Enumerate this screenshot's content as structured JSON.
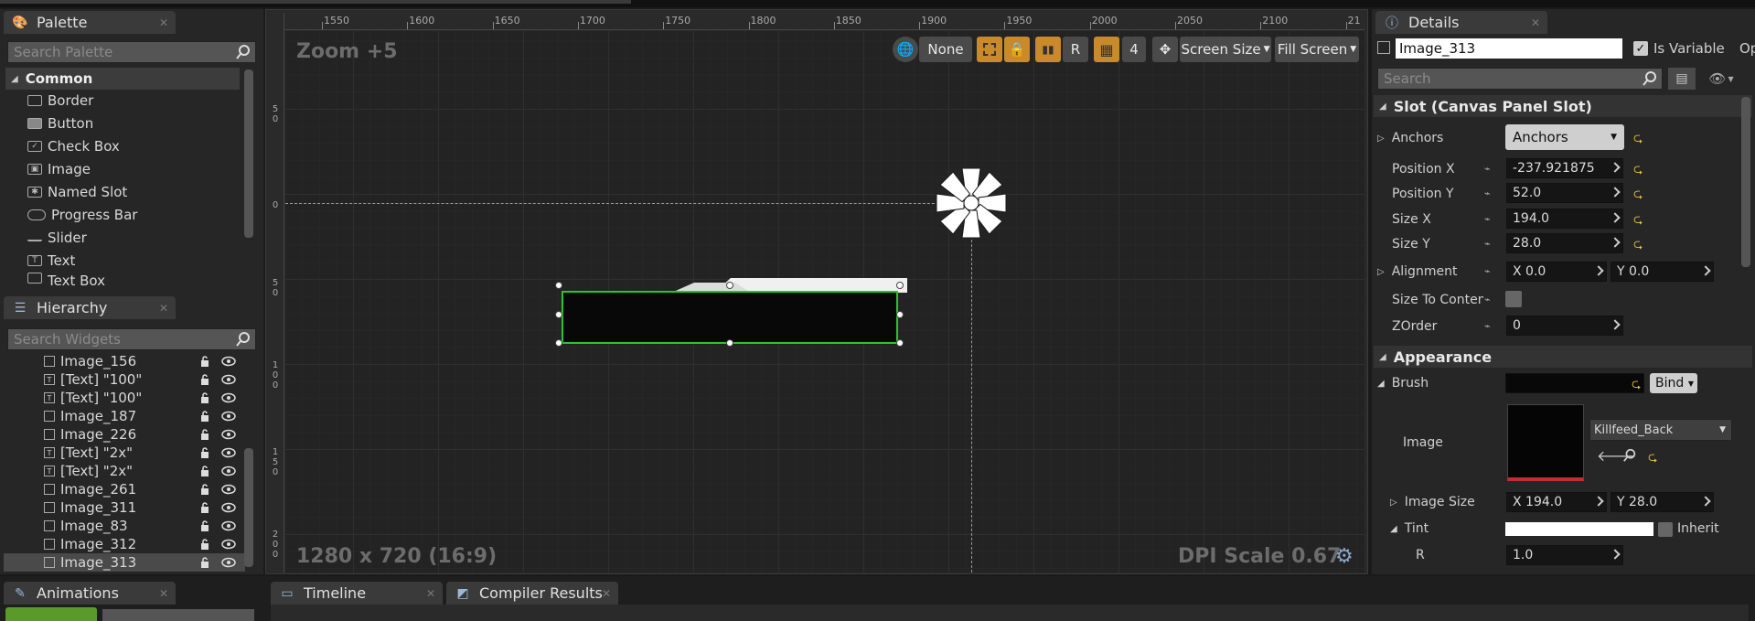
{
  "palette": {
    "tab": "Palette",
    "search_placeholder": "Search Palette",
    "category": "Common",
    "items": [
      "Border",
      "Button",
      "Check Box",
      "Image",
      "Named Slot",
      "Progress Bar",
      "Slider",
      "Text",
      "Text Box"
    ]
  },
  "hierarchy": {
    "tab": "Hierarchy",
    "search_placeholder": "Search Widgets",
    "rows": [
      "Image_156",
      "[Text] \"100\"",
      "[Text] \"100\"",
      "Image_187",
      "Image_226",
      "[Text] \"2x\"",
      "[Text] \"2x\"",
      "Image_261",
      "Image_311",
      "Image_83",
      "Image_312",
      "Image_313"
    ],
    "selected": "Image_313"
  },
  "designer": {
    "zoom": "Zoom +5",
    "resolution": "1280 x 720 (16:9)",
    "dpi": "DPI Scale 0.67",
    "ruler_top": [
      "1550",
      "1600",
      "1650",
      "1700",
      "1750",
      "1800",
      "1850",
      "1900",
      "1950",
      "2000",
      "2050",
      "2100",
      "21"
    ],
    "ruler_left": [
      "5\n0",
      "0",
      "5\n0",
      "1\n0\n0",
      "1\n5\n0",
      "2\n0\n0"
    ],
    "toolbar": {
      "none": "None",
      "r": "R",
      "grid_num": "4",
      "screen_size": "Screen Size",
      "fill_screen": "Fill Screen"
    }
  },
  "bottom_tabs": {
    "animations": "Animations",
    "timeline": "Timeline",
    "compiler": "Compiler Results"
  },
  "details": {
    "tab": "Details",
    "name": "Image_313",
    "is_variable": "Is Variable",
    "op": "Op",
    "search_placeholder": "Search",
    "slot_section": "Slot (Canvas Panel Slot)",
    "anchors_label": "Anchors",
    "anchors_value": "Anchors",
    "position_x_label": "Position X",
    "position_x": "-237.921875",
    "position_y_label": "Position Y",
    "position_y": "52.0",
    "size_x_label": "Size X",
    "size_x": "194.0",
    "size_y_label": "Size Y",
    "size_y": "28.0",
    "alignment_label": "Alignment",
    "alignment_x": "X  0.0",
    "alignment_y": "Y  0.0",
    "size_to_content": "Size To Content",
    "zorder_label": "ZOrder",
    "zorder": "0",
    "appearance_section": "Appearance",
    "brush_label": "Brush",
    "bind": "Bind",
    "image_label": "Image",
    "image_asset": "Killfeed_Back",
    "image_size_label": "Image Size",
    "image_size_x": "X  194.0",
    "image_size_y": "Y  28.0",
    "tint_label": "Tint",
    "inherit": "Inherit",
    "r_label": "R",
    "r_value": "1.0"
  }
}
